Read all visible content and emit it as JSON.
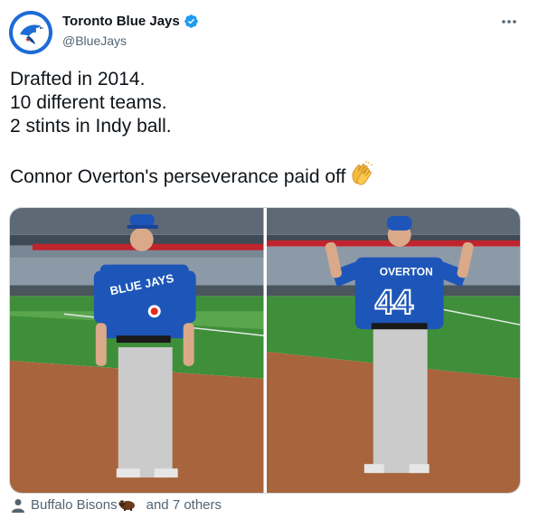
{
  "author": {
    "display_name": "Toronto Blue Jays",
    "handle": "@BlueJays",
    "avatar_icon": "blue-jays-logo-icon",
    "verified": true,
    "verified_color": "#1d9bf0"
  },
  "tweet": {
    "lines": [
      "Drafted in 2014.",
      "10 different teams.",
      "2 stints in Indy ball."
    ],
    "closing_line": "Connor Overton's perseverance paid off",
    "closing_emoji": "clapping-hands-icon"
  },
  "media": {
    "photo_1": {
      "jersey_text": "BLUE JAYS"
    },
    "photo_2": {
      "jersey_name": "OVERTON",
      "jersey_number": "44"
    }
  },
  "tags": {
    "icon": "person-icon",
    "first_tag": "Buffalo Bisons",
    "tag_emoji": "bison-icon",
    "others_text": "and 7 others"
  },
  "colors": {
    "brand_blue": "#1d6bd6",
    "text_primary": "#0f1419",
    "text_secondary": "#536471"
  }
}
